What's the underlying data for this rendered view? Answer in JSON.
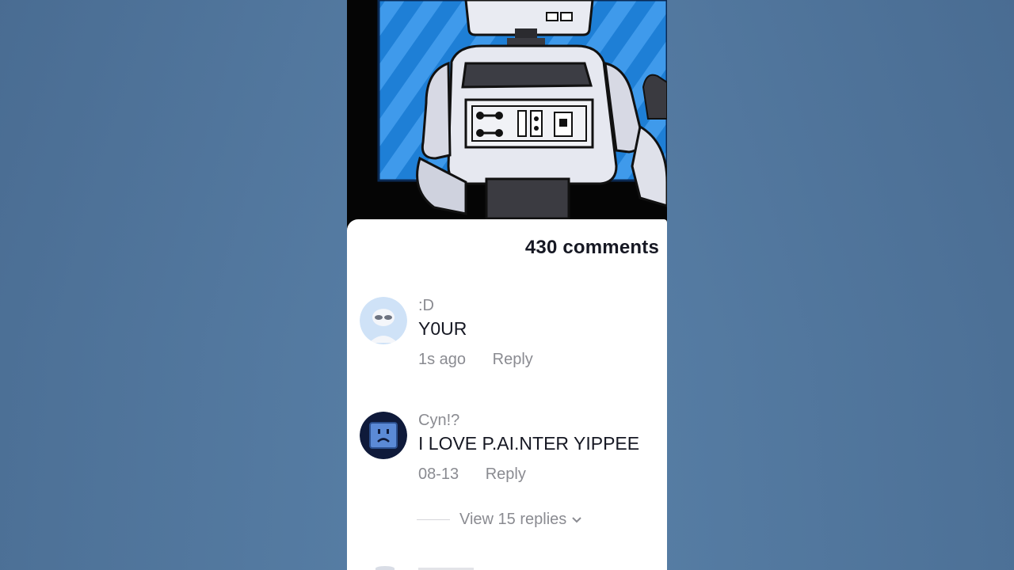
{
  "comments_panel": {
    "count_label": "430 comments",
    "comments": [
      {
        "username": ":D",
        "text": "Y0UR",
        "time": "1s ago",
        "reply_label": "Reply",
        "avatar_icon": "robot-face-avatar-icon"
      },
      {
        "username": "Cyn!?",
        "text": "I LOVE P.AI.NTER YIPPEE",
        "time": "08-13",
        "reply_label": "Reply",
        "avatar_icon": "sad-monitor-avatar-icon",
        "view_replies_label": "View 15 replies"
      }
    ]
  },
  "colors": {
    "background": "#4b6f96",
    "sheet": "#ffffff",
    "primary_text": "#161823",
    "secondary_text": "#8a8b91"
  }
}
